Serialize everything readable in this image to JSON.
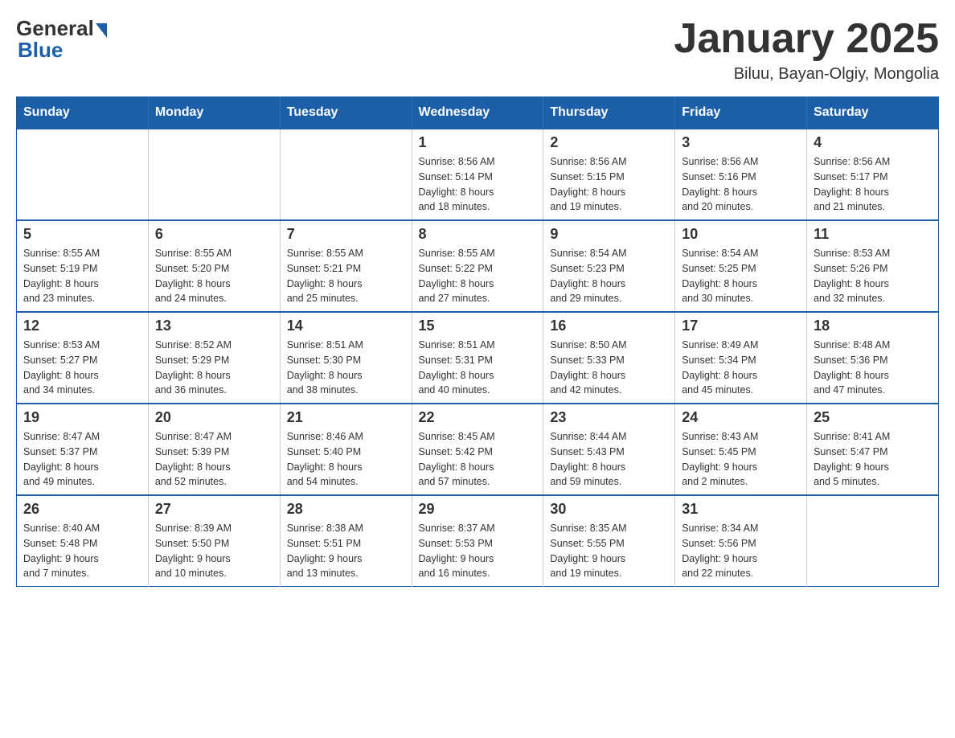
{
  "header": {
    "logo": {
      "general": "General",
      "blue": "Blue"
    },
    "title": "January 2025",
    "location": "Biluu, Bayan-Olgiy, Mongolia"
  },
  "days_of_week": [
    "Sunday",
    "Monday",
    "Tuesday",
    "Wednesday",
    "Thursday",
    "Friday",
    "Saturday"
  ],
  "weeks": [
    {
      "days": [
        {
          "num": "",
          "info": ""
        },
        {
          "num": "",
          "info": ""
        },
        {
          "num": "",
          "info": ""
        },
        {
          "num": "1",
          "info": "Sunrise: 8:56 AM\nSunset: 5:14 PM\nDaylight: 8 hours\nand 18 minutes."
        },
        {
          "num": "2",
          "info": "Sunrise: 8:56 AM\nSunset: 5:15 PM\nDaylight: 8 hours\nand 19 minutes."
        },
        {
          "num": "3",
          "info": "Sunrise: 8:56 AM\nSunset: 5:16 PM\nDaylight: 8 hours\nand 20 minutes."
        },
        {
          "num": "4",
          "info": "Sunrise: 8:56 AM\nSunset: 5:17 PM\nDaylight: 8 hours\nand 21 minutes."
        }
      ]
    },
    {
      "days": [
        {
          "num": "5",
          "info": "Sunrise: 8:55 AM\nSunset: 5:19 PM\nDaylight: 8 hours\nand 23 minutes."
        },
        {
          "num": "6",
          "info": "Sunrise: 8:55 AM\nSunset: 5:20 PM\nDaylight: 8 hours\nand 24 minutes."
        },
        {
          "num": "7",
          "info": "Sunrise: 8:55 AM\nSunset: 5:21 PM\nDaylight: 8 hours\nand 25 minutes."
        },
        {
          "num": "8",
          "info": "Sunrise: 8:55 AM\nSunset: 5:22 PM\nDaylight: 8 hours\nand 27 minutes."
        },
        {
          "num": "9",
          "info": "Sunrise: 8:54 AM\nSunset: 5:23 PM\nDaylight: 8 hours\nand 29 minutes."
        },
        {
          "num": "10",
          "info": "Sunrise: 8:54 AM\nSunset: 5:25 PM\nDaylight: 8 hours\nand 30 minutes."
        },
        {
          "num": "11",
          "info": "Sunrise: 8:53 AM\nSunset: 5:26 PM\nDaylight: 8 hours\nand 32 minutes."
        }
      ]
    },
    {
      "days": [
        {
          "num": "12",
          "info": "Sunrise: 8:53 AM\nSunset: 5:27 PM\nDaylight: 8 hours\nand 34 minutes."
        },
        {
          "num": "13",
          "info": "Sunrise: 8:52 AM\nSunset: 5:29 PM\nDaylight: 8 hours\nand 36 minutes."
        },
        {
          "num": "14",
          "info": "Sunrise: 8:51 AM\nSunset: 5:30 PM\nDaylight: 8 hours\nand 38 minutes."
        },
        {
          "num": "15",
          "info": "Sunrise: 8:51 AM\nSunset: 5:31 PM\nDaylight: 8 hours\nand 40 minutes."
        },
        {
          "num": "16",
          "info": "Sunrise: 8:50 AM\nSunset: 5:33 PM\nDaylight: 8 hours\nand 42 minutes."
        },
        {
          "num": "17",
          "info": "Sunrise: 8:49 AM\nSunset: 5:34 PM\nDaylight: 8 hours\nand 45 minutes."
        },
        {
          "num": "18",
          "info": "Sunrise: 8:48 AM\nSunset: 5:36 PM\nDaylight: 8 hours\nand 47 minutes."
        }
      ]
    },
    {
      "days": [
        {
          "num": "19",
          "info": "Sunrise: 8:47 AM\nSunset: 5:37 PM\nDaylight: 8 hours\nand 49 minutes."
        },
        {
          "num": "20",
          "info": "Sunrise: 8:47 AM\nSunset: 5:39 PM\nDaylight: 8 hours\nand 52 minutes."
        },
        {
          "num": "21",
          "info": "Sunrise: 8:46 AM\nSunset: 5:40 PM\nDaylight: 8 hours\nand 54 minutes."
        },
        {
          "num": "22",
          "info": "Sunrise: 8:45 AM\nSunset: 5:42 PM\nDaylight: 8 hours\nand 57 minutes."
        },
        {
          "num": "23",
          "info": "Sunrise: 8:44 AM\nSunset: 5:43 PM\nDaylight: 8 hours\nand 59 minutes."
        },
        {
          "num": "24",
          "info": "Sunrise: 8:43 AM\nSunset: 5:45 PM\nDaylight: 9 hours\nand 2 minutes."
        },
        {
          "num": "25",
          "info": "Sunrise: 8:41 AM\nSunset: 5:47 PM\nDaylight: 9 hours\nand 5 minutes."
        }
      ]
    },
    {
      "days": [
        {
          "num": "26",
          "info": "Sunrise: 8:40 AM\nSunset: 5:48 PM\nDaylight: 9 hours\nand 7 minutes."
        },
        {
          "num": "27",
          "info": "Sunrise: 8:39 AM\nSunset: 5:50 PM\nDaylight: 9 hours\nand 10 minutes."
        },
        {
          "num": "28",
          "info": "Sunrise: 8:38 AM\nSunset: 5:51 PM\nDaylight: 9 hours\nand 13 minutes."
        },
        {
          "num": "29",
          "info": "Sunrise: 8:37 AM\nSunset: 5:53 PM\nDaylight: 9 hours\nand 16 minutes."
        },
        {
          "num": "30",
          "info": "Sunrise: 8:35 AM\nSunset: 5:55 PM\nDaylight: 9 hours\nand 19 minutes."
        },
        {
          "num": "31",
          "info": "Sunrise: 8:34 AM\nSunset: 5:56 PM\nDaylight: 9 hours\nand 22 minutes."
        },
        {
          "num": "",
          "info": ""
        }
      ]
    }
  ]
}
